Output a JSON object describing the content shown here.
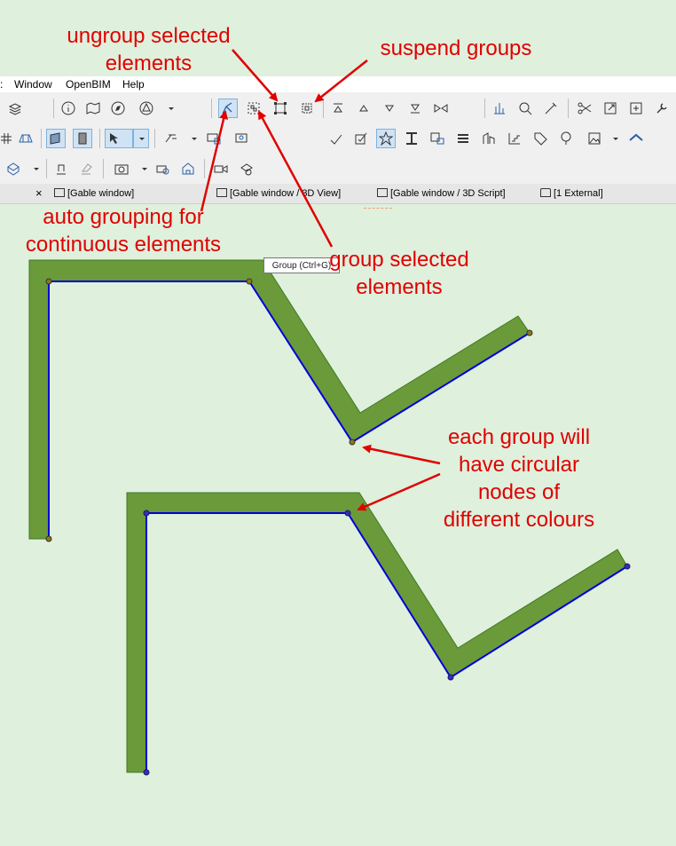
{
  "menu": {
    "items": [
      "Window",
      "OpenBIM",
      "Help"
    ]
  },
  "tooltip": {
    "text": "Group (Ctrl+G)"
  },
  "tabs": [
    {
      "label": "[Gable window]",
      "icon": "plan-icon"
    },
    {
      "label": "[Gable window / 3D View]",
      "icon": "3d-view-icon"
    },
    {
      "label": "[Gable window / 3D Script]",
      "icon": "script-icon"
    },
    {
      "label": "[1 External]",
      "icon": "house-icon"
    }
  ],
  "close_tab_glyph": "×",
  "annotations": {
    "ungroup": "ungroup selected\nelements",
    "suspend": "suspend groups",
    "auto_grouping": "auto grouping for\ncontinuous elements",
    "group_selected": "group selected\nelements",
    "each_group": "each group will\nhave circular\nnodes of\ndifferent colours"
  },
  "colors": {
    "annotation": "#e00000",
    "wall_fill": "#6a9a3a",
    "reference_line": "#0000d8",
    "node_group_1": "#8a7a1a",
    "node_group_2": "#3a2cb8",
    "canvas_bg": "#dff0dd"
  }
}
